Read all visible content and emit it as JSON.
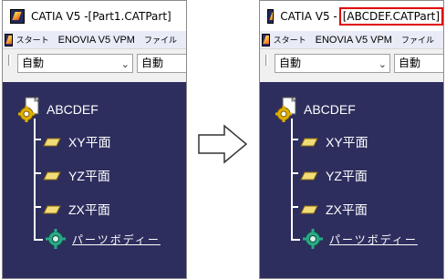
{
  "left": {
    "title": {
      "app": "CATIA V5 - ",
      "file": "[Part1.CATPart]"
    },
    "menu": {
      "start": "スタート",
      "enovia": "ENOVIA V5 VPM",
      "file": "ファイル"
    },
    "toolbar": {
      "combo1": "自動",
      "combo2": "自動"
    },
    "tree": {
      "part": "ABCDEF",
      "planes": [
        "XY平面",
        "YZ平面",
        "ZX平面"
      ],
      "body": "パーツボディー"
    }
  },
  "right": {
    "title": {
      "app": "CATIA V5 - ",
      "file": "[ABCDEF.CATPart]"
    },
    "menu": {
      "start": "スタート",
      "enovia": "ENOVIA V5 VPM",
      "file": "ファイル"
    },
    "toolbar": {
      "combo1": "自動",
      "combo2": "自動"
    },
    "tree": {
      "part": "ABCDEF",
      "planes": [
        "XY平面",
        "YZ平面",
        "ZX平面"
      ],
      "body": "パーツボディー"
    }
  },
  "colors": {
    "viewport_bg": "#2d2e5e",
    "highlight": "#e00000",
    "menubar_bg": "#e9ebf7"
  },
  "icons": {
    "app": "catia-logo-icon",
    "part": "part-document-icon",
    "plane": "plane-icon",
    "body": "part-body-icon",
    "arrow": "right-arrow-icon"
  }
}
